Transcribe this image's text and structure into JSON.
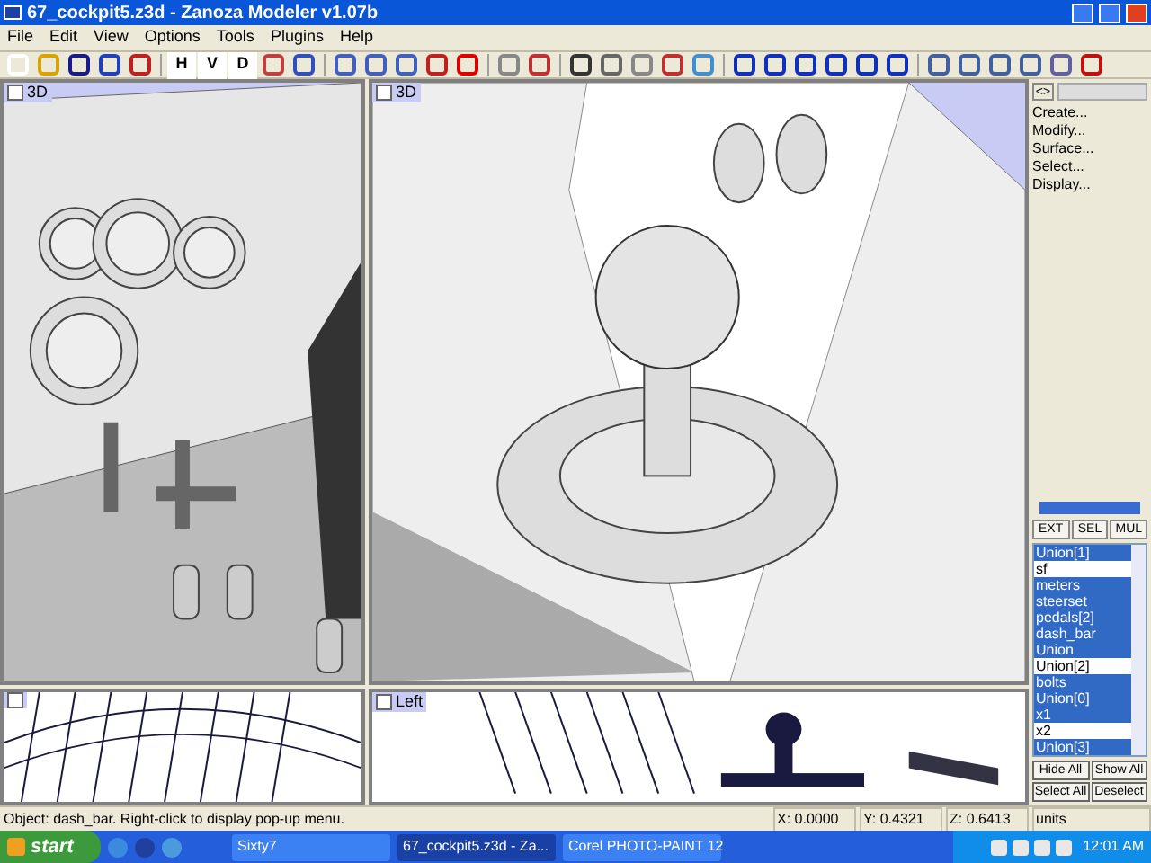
{
  "window": {
    "title": "67_cockpit5.z3d - Zanoza Modeler v1.07b"
  },
  "menu": [
    "File",
    "Edit",
    "View",
    "Options",
    "Tools",
    "Plugins",
    "Help"
  ],
  "toolbar": {
    "view_letters": [
      "H",
      "V",
      "D"
    ]
  },
  "viewports": [
    {
      "label": "3D",
      "kind": "cockpit"
    },
    {
      "label": "3D",
      "kind": "knob"
    },
    {
      "kind": "wire-left"
    },
    {
      "label": "Left",
      "kind": "wire-side"
    }
  ],
  "panel": {
    "toggle": "<>",
    "commands": [
      "Create...",
      "Modify...",
      "Surface...",
      "Select...",
      "Display..."
    ],
    "mode_buttons": [
      "EXT",
      "SEL",
      "MUL"
    ],
    "objects": [
      {
        "name": "Union[1]",
        "selected": true
      },
      {
        "name": "sf",
        "selected": false
      },
      {
        "name": "meters",
        "selected": true
      },
      {
        "name": "steerset",
        "selected": true
      },
      {
        "name": "pedals[2]",
        "selected": true
      },
      {
        "name": "dash_bar",
        "selected": true
      },
      {
        "name": "Union",
        "selected": true
      },
      {
        "name": "Union[2]",
        "selected": false
      },
      {
        "name": "bolts",
        "selected": true
      },
      {
        "name": "Union[0]",
        "selected": true
      },
      {
        "name": "x1",
        "selected": true
      },
      {
        "name": "x2",
        "selected": false
      },
      {
        "name": "Union[3]",
        "selected": true
      }
    ],
    "actions": [
      "Hide All",
      "Show All",
      "Select All",
      "Deselect"
    ]
  },
  "status_bar": {
    "message": "Object: dash_bar. Right-click to display pop-up menu.",
    "x": "X: 0.0000",
    "y": "Y: 0.4321",
    "z": "Z: 0.6413",
    "units": "units"
  },
  "taskbar": {
    "start": "start",
    "tasks": [
      {
        "label": "Sixty7",
        "selected": false
      },
      {
        "label": "67_cockpit5.z3d - Za...",
        "selected": true
      },
      {
        "label": "Corel PHOTO-PAINT 12",
        "selected": false
      }
    ],
    "clock": "12:01 AM"
  }
}
